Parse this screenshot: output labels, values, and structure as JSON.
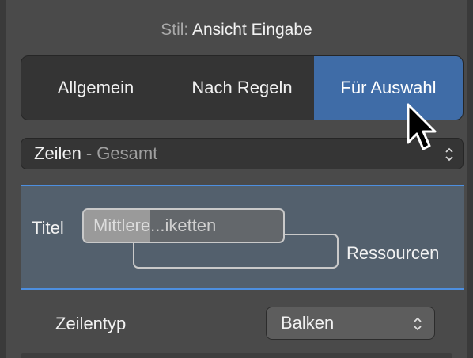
{
  "header": {
    "style_label": "Stil:",
    "style_value": "Ansicht Eingabe"
  },
  "tabs": [
    {
      "label": "Allgemein",
      "selected": false
    },
    {
      "label": "Nach Regeln",
      "selected": false
    },
    {
      "label": "Für Auswahl",
      "selected": true
    }
  ],
  "selector": {
    "main": "Zeilen",
    "separator": "-",
    "sub": "Gesamt",
    "icon": "up-down-chevrons-icon"
  },
  "title_row": {
    "label": "Titel",
    "field_selected_text": "Mittlere",
    "field_rest_text": "...iketten",
    "resource_label": "Ressourcen"
  },
  "row_type": {
    "label": "Zeilentyp",
    "value": "Balken",
    "icon": "up-down-chevrons-icon"
  },
  "colors": {
    "accent": "#4d8fe0",
    "selected_tab": "#3f6ca7",
    "panel": "#53606d"
  }
}
